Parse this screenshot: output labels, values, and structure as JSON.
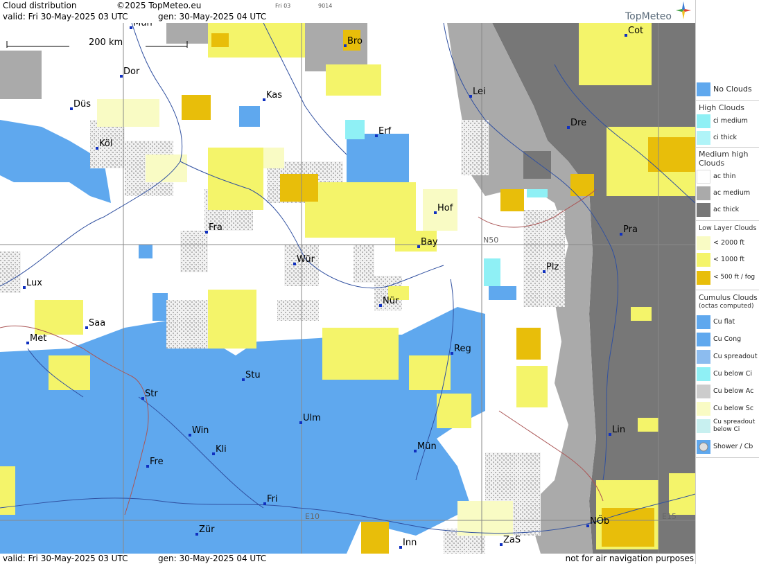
{
  "header": {
    "title": "Cloud distribution",
    "copyright": "©2025 TopMeteo.eu",
    "valid": "valid:  Fri  30-May-2025  03 UTC",
    "gen": "gen: 30-May-2025 04 UTC",
    "code1": "Fri 03",
    "code2": "9014",
    "logo": "TopMeteo"
  },
  "footer": {
    "valid": "valid:  Fri  30-May-2025  03 UTC",
    "gen": "gen: 30-May-2025 04 UTC",
    "disclaimer": "not for air navigation purposes"
  },
  "map": {
    "scale_label": "200 km",
    "grid_labels": [
      "N50",
      "E10",
      "E15"
    ],
    "cities": [
      "Mün",
      "Bro",
      "Cot",
      "Dor",
      "Kas",
      "Lei",
      "Düs",
      "Erf",
      "Dre",
      "Köl",
      "Hof",
      "Fra",
      "Pra",
      "Bay",
      "Wür",
      "Plz",
      "Lux",
      "Nür",
      "Saa",
      "Met",
      "Reg",
      "Stu",
      "Str",
      "Ulm",
      "Win",
      "Kli",
      "Mün",
      "Lin",
      "Fre",
      "Fri",
      "NÖb",
      "Zür",
      "Inn",
      "ZaS"
    ]
  },
  "legend": {
    "no_clouds": "No Clouds",
    "high_head": "High Clouds",
    "ci_medium": "ci medium",
    "ci_thick": "ci thick",
    "medium_head_1": "Medium high",
    "medium_head_2": "Clouds",
    "ac_thin": "ac thin",
    "ac_medium": "ac medium",
    "ac_thick": "ac thick",
    "low_head": "Low Layer Clouds",
    "low_2000": "< 2000 ft",
    "low_1000": "< 1000 ft",
    "low_500": "< 500 ft / fog",
    "cu_head": "Cumulus Clouds",
    "cu_sub": "(octas computed)",
    "cu_flat": "Cu flat",
    "cu_cong": "Cu Cong",
    "cu_spreadout": "Cu spreadout",
    "cu_below_ci": "Cu below Ci",
    "cu_below_ac": "Cu below Ac",
    "cu_below_sc": "Cu below Sc",
    "cu_spread_ci_1": "Cu spreadout",
    "cu_spread_ci_2": "below Ci",
    "shower": "Shower / Cb"
  },
  "colors": {
    "no_clouds": "#5fa8ee",
    "ci_medium": "#8ff0f5",
    "ac_thin": "#ffffff",
    "ac_medium": "#aaaaaa",
    "ac_thick": "#777777",
    "low_2000": "#f9fbc4",
    "low_1000": "#f4f46a",
    "low_500": "#e8be0a",
    "cu_below_ac": "#cccccc"
  }
}
